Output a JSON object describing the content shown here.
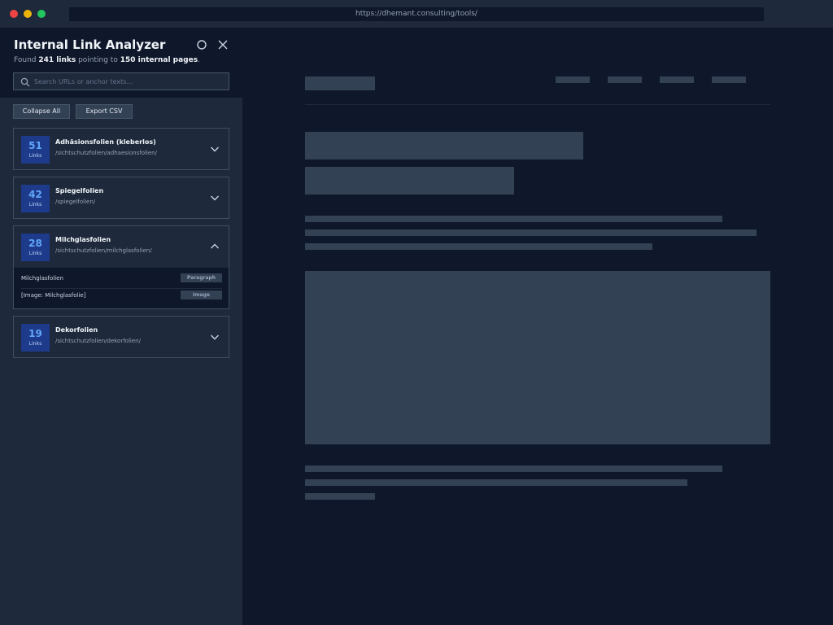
{
  "browser": {
    "url": "https://dhemant.consulting/tools/"
  },
  "panel": {
    "title": "Internal Link Analyzer",
    "summary": {
      "prefix": "Found ",
      "links": "241 links",
      "middle": " pointing to ",
      "pages": "150 internal pages",
      "suffix": "."
    },
    "search_placeholder": "Search URLs or anchor texts...",
    "buttons": {
      "collapse": "Collapse All",
      "export": "Export CSV"
    },
    "groups": [
      {
        "count": "51",
        "count_label": "Links",
        "name": "Adhäsionsfolien (kleberlos)",
        "path": "/sichtschutzfolien/adhaesionsfolien/",
        "expanded": false
      },
      {
        "count": "42",
        "count_label": "Links",
        "name": "Spiegelfolien",
        "path": "/spiegelfolien/",
        "expanded": false
      },
      {
        "count": "28",
        "count_label": "Links",
        "name": "Milchglasfolien",
        "path": "/sichtschutzfolien/milchglasfolien/",
        "expanded": true,
        "links": [
          {
            "anchor": "Milchglasfolien",
            "type": "Paragraph"
          },
          {
            "anchor": "[Image: Milchglasfolie]",
            "type": "Image"
          }
        ]
      },
      {
        "count": "19",
        "count_label": "Links",
        "name": "Dekorfolien",
        "path": "/sichtschutzfolien/dekorfolien/",
        "expanded": false
      }
    ]
  },
  "colors": {
    "background": "#0f172a",
    "panel": "#1e293b",
    "badge": "#1e3a8a",
    "badge_number": "#60a5fa",
    "placeholder": "#334155"
  },
  "icons": {
    "close": "close-icon",
    "circle": "circle-icon",
    "search": "search-icon",
    "chevron_down": "chevron-down-icon",
    "chevron_up": "chevron-up-icon"
  }
}
